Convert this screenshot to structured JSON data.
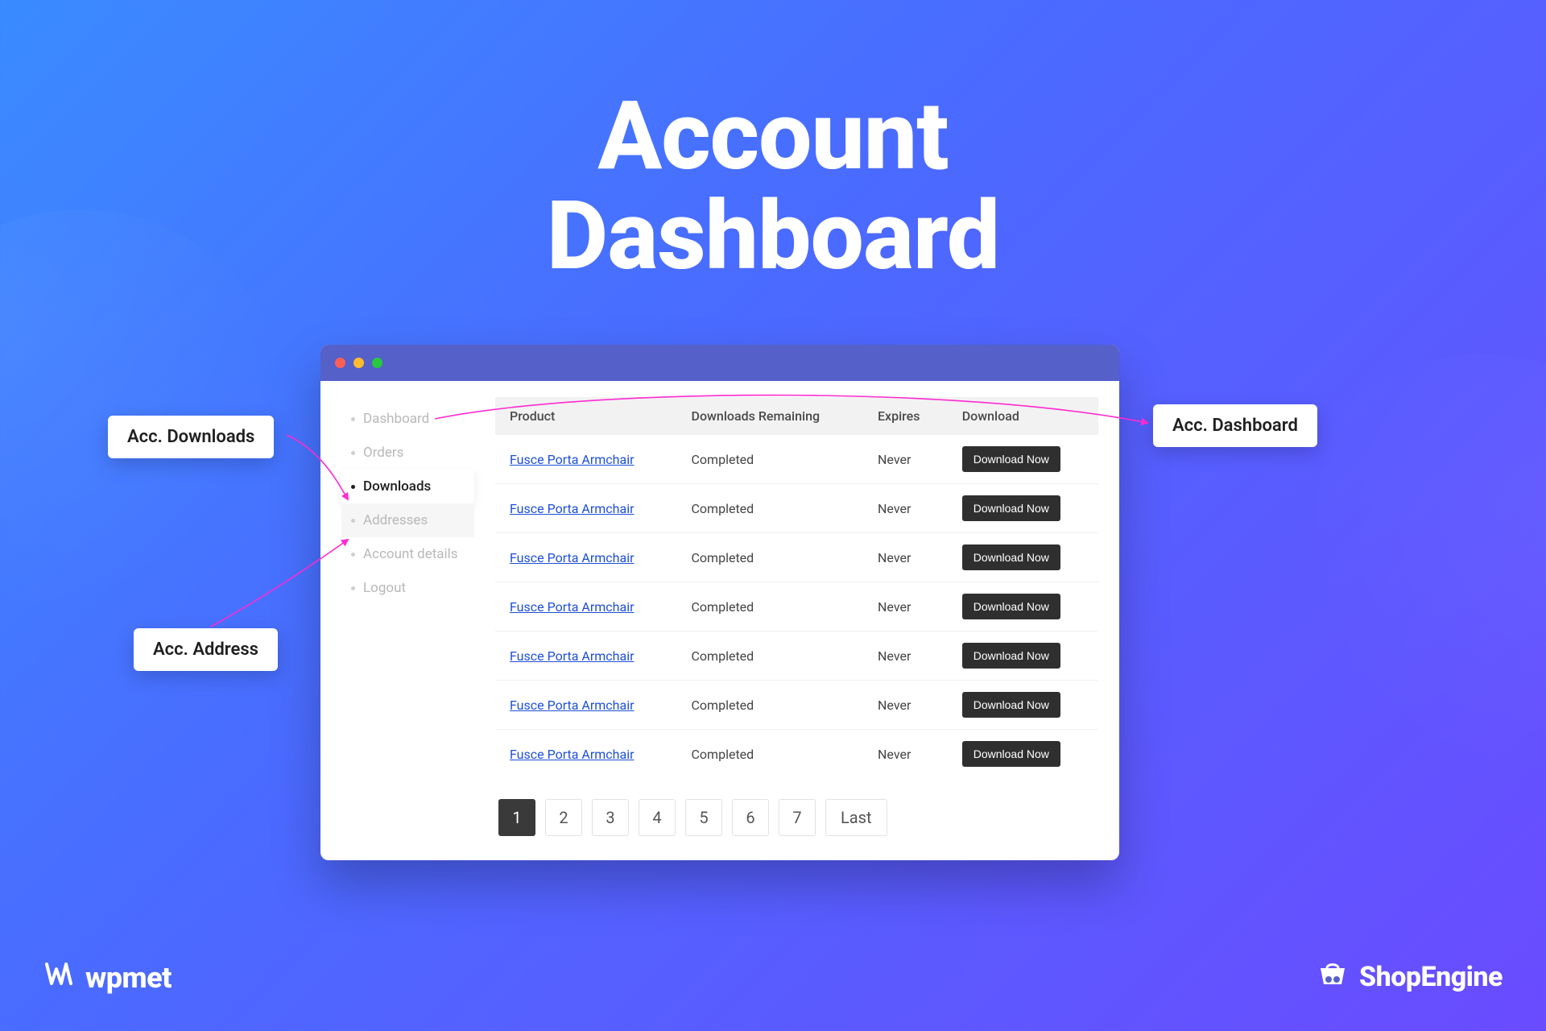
{
  "hero": {
    "title_line1": "Account",
    "title_line2": "Dashboard"
  },
  "annotations": {
    "downloads": "Acc. Downloads",
    "address": "Acc. Address",
    "dashboard": "Acc. Dashboard"
  },
  "sidebar": {
    "items": [
      {
        "label": "Dashboard"
      },
      {
        "label": "Orders"
      },
      {
        "label": "Downloads"
      },
      {
        "label": "Addresses"
      },
      {
        "label": "Account details"
      },
      {
        "label": "Logout"
      }
    ]
  },
  "table": {
    "headers": {
      "product": "Product",
      "remaining": "Downloads Remaining",
      "expires": "Expires",
      "download": "Download"
    },
    "rows": [
      {
        "product": "Fusce Porta Armchair",
        "remaining": "Completed",
        "expires": "Never",
        "button": "Download Now"
      },
      {
        "product": "Fusce Porta Armchair",
        "remaining": "Completed",
        "expires": "Never",
        "button": "Download Now"
      },
      {
        "product": "Fusce Porta Armchair",
        "remaining": "Completed",
        "expires": "Never",
        "button": "Download Now"
      },
      {
        "product": "Fusce Porta Armchair",
        "remaining": "Completed",
        "expires": "Never",
        "button": "Download Now"
      },
      {
        "product": "Fusce Porta Armchair",
        "remaining": "Completed",
        "expires": "Never",
        "button": "Download Now"
      },
      {
        "product": "Fusce Porta Armchair",
        "remaining": "Completed",
        "expires": "Never",
        "button": "Download Now"
      },
      {
        "product": "Fusce Porta Armchair",
        "remaining": "Completed",
        "expires": "Never",
        "button": "Download Now"
      }
    ]
  },
  "pagination": {
    "pages": [
      "1",
      "2",
      "3",
      "4",
      "5",
      "6",
      "7"
    ],
    "last": "Last",
    "active": "1"
  },
  "footer": {
    "left_brand": "wpmet",
    "right_brand": "ShopEngine"
  },
  "colors": {
    "accent_purple": "#5560c9",
    "button_dark": "#2f2f2f",
    "link": "#1d4ed8",
    "connector": "#ff2bd1"
  }
}
